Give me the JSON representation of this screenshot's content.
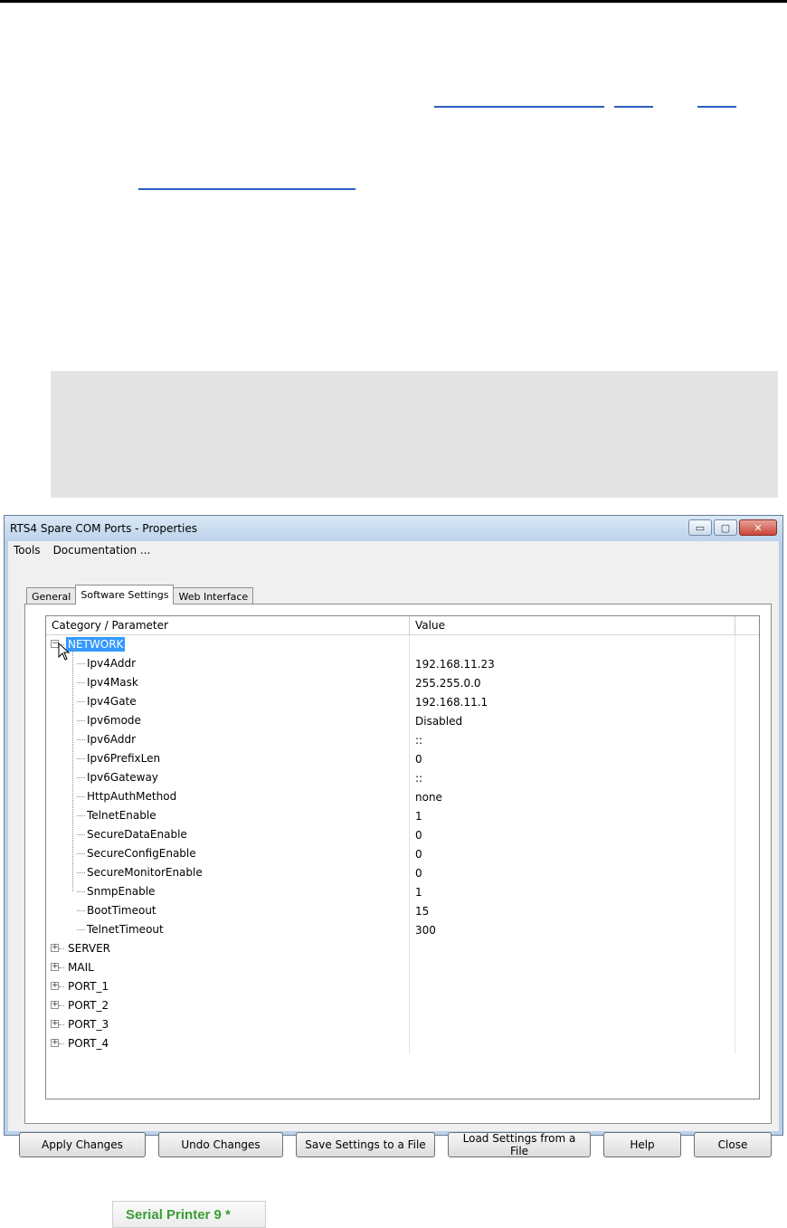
{
  "window": {
    "title": "RTS4 Spare COM Ports - Properties",
    "caption_minimize": "▭",
    "caption_maximize": "▢",
    "caption_close": "✕"
  },
  "menu": [
    "Tools",
    "Documentation ..."
  ],
  "tabs": [
    {
      "label": "General",
      "active": false
    },
    {
      "label": "Software Settings",
      "active": true
    },
    {
      "label": "Web Interface",
      "active": false
    }
  ],
  "tree": {
    "headers": {
      "col1": "Category / Parameter",
      "col2": "Value"
    },
    "expanded_category": "NETWORK",
    "parameters": [
      {
        "name": "Ipv4Addr",
        "value": "192.168.11.23"
      },
      {
        "name": "Ipv4Mask",
        "value": "255.255.0.0"
      },
      {
        "name": "Ipv4Gate",
        "value": "192.168.11.1"
      },
      {
        "name": "Ipv6mode",
        "value": "Disabled"
      },
      {
        "name": "Ipv6Addr",
        "value": "::"
      },
      {
        "name": "Ipv6PrefixLen",
        "value": "0"
      },
      {
        "name": "Ipv6Gateway",
        "value": "::"
      },
      {
        "name": "HttpAuthMethod",
        "value": "none"
      },
      {
        "name": "TelnetEnable",
        "value": "1"
      },
      {
        "name": "SecureDataEnable",
        "value": "0"
      },
      {
        "name": "SecureConfigEnable",
        "value": "0"
      },
      {
        "name": "SecureMonitorEnable",
        "value": "0"
      },
      {
        "name": "SnmpEnable",
        "value": "1"
      },
      {
        "name": "BootTimeout",
        "value": "15"
      },
      {
        "name": "TelnetTimeout",
        "value": "300"
      }
    ],
    "collapsed_categories": [
      "SERVER",
      "MAIL",
      "PORT_1",
      "PORT_2",
      "PORT_3",
      "PORT_4"
    ]
  },
  "buttons": {
    "apply": "Apply Changes",
    "undo": "Undo Changes",
    "save": "Save Settings to a File",
    "load": "Load Settings from a File",
    "help": "Help",
    "close": "Close"
  },
  "serial_tag": "Serial Printer 9 *",
  "colors": {
    "selection": "#3399ff",
    "serial_text": "#3b9d34"
  }
}
